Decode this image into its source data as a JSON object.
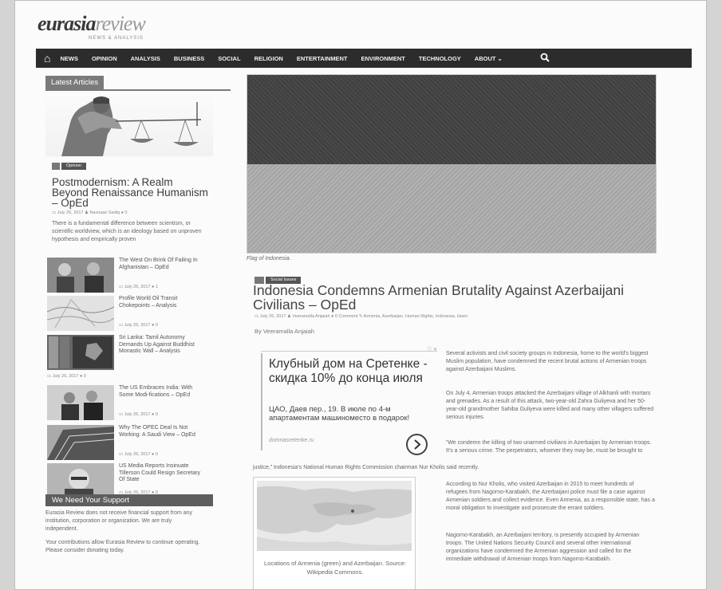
{
  "site": {
    "logo_main": "eurasia",
    "logo_rest": "review",
    "logo_sub": "NEWS & ANALYSIS"
  },
  "nav": {
    "items": [
      "NEWS",
      "OPINION",
      "ANALYSIS",
      "BUSINESS",
      "SOCIAL",
      "RELIGION",
      "ENTERTAINMENT",
      "ENVIRONMENT",
      "TECHNOLOGY",
      "ABOUT ⌄"
    ],
    "home_icon": "home-icon",
    "search_icon": "search-icon"
  },
  "sidebar": {
    "title": "Latest Articles",
    "featured": {
      "category": "Opinion",
      "title": "Postmodernism: A Realm Beyond Renaissance Humanism – OpEd",
      "meta": "▭ July 26, 2017   ♟ Navnaan Sadiq   ● 0",
      "excerpt": "There is a fundamental difference between scientism, or scientific worldview, which is an ideology based on unproven hypothesis and empirically proven"
    },
    "items": [
      {
        "title": "The West On Brink Of Failing In Afghanistan – OpEd",
        "meta": "▭ July 26, 2017   ● 1"
      },
      {
        "title": "Profile World Oil Transit Chokepoints – Analysis",
        "meta": "▭ July 26, 2017   ● 0"
      },
      {
        "title": "Sri Lanka: Tamil Autonomy Demands Up Against Buddhist Monastic Wall – Analysis",
        "meta": "▭ July 26, 2017   ● 0"
      },
      {
        "title": "The US Embraces India: With Some Modi-fications – OpEd",
        "meta": "▭ July 26, 2017   ● 0"
      },
      {
        "title": "Why The OPEC Deal Is Not Working: A Saudi View – OpEd",
        "meta": "▭ July 26, 2017   ● 0"
      },
      {
        "title": "US Media Reports Insinuate Tillerson Could Resign Secretary Of State",
        "meta": "▭ July 26, 2017   ● 0"
      }
    ],
    "support_title": "We Need Your Support",
    "support_p1": "Eurasia Review does not receive financial support from any institution, corporation or organization. We are truly independent.",
    "support_p2": "Your contributions allow Eurasia Review to continue operating. Please consider donating today."
  },
  "article": {
    "image_caption": "Flag of Indonesia.",
    "category": "Social Issues",
    "title": "Indonesia Condemns Armenian Brutality Against Azerbaijani Civilians – OpEd",
    "meta": "▭ July 26, 2017   ♟ Veeramalla Anjaiah   ● 0 Comment   ✎ Armenia, Azerbaijan, Human Rights, Indonesia, Islam",
    "byline": "By Veeramalla Anjaiah",
    "ad": {
      "headline": "Клубный дом на Сретенке - скидка 10% до конца июля",
      "desc": "ЦАО, Даев пер., 19. В июле по 4-м апартаментам машиноместо в подарок!",
      "domain": "domnasretenke.ru",
      "icons": "ⓘ ✕"
    },
    "p1": "Several activists and civil society groups in Indonesia, home to the world's biggest Muslim population, have condemned the recent brutal actions of Armenian troops against Azerbaijani Muslims.",
    "p2": "On July 4, Armenian troops attacked the Azerbaijani village of Alkhanli with mortars and grenades. As a result of this attack, two-year-old Zahra Guliyeva and her 50-year-old grandmother Sahiba Guliyeva were killed and many other villagers suffered serious injuries.",
    "p3a": "“We condemn the killing of two unarmed civilians in Azerbaijan by Armenian troops. It's a serious crime. The perpetrators, whoever they may be, must be brought to",
    "p3b": "justice,” Indonesia's National Human Rights Commission chairman Nur Kholis said recently.",
    "map_caption": "Locations of Armenia (green) and Azerbaijan. Source: Wikipedia Commons.",
    "p4": "According to Nur Kholis, who visited Azerbaijan in 2015 to meet hundreds of refugees from Nagorno-Karabakh, the Azerbaijani police must file a case against Armenian soldiers and collect evidence. Even Armenia, as a responsible state, has a moral obligation to investigate and prosecute the errant soldiers.",
    "p5": "Nagorno-Karabakh, an Azerbaijani territory, is presently occupied by Armenian troops. The United Nations Security Council and several other international organizations have condemned the Armenian aggression and called for the immediate withdrawal of Armenian troops from Nagorno-Karabakh."
  }
}
